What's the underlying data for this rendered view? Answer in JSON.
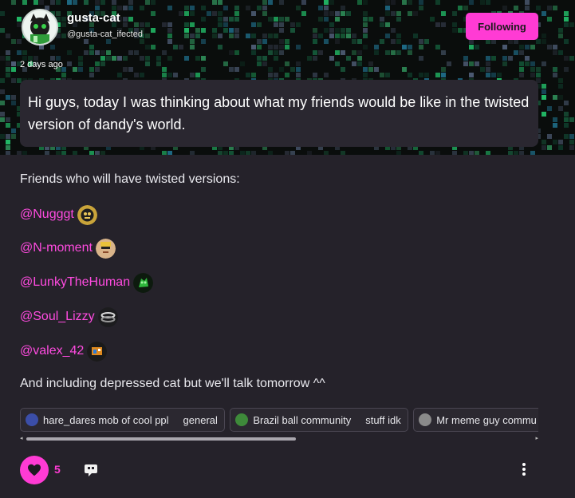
{
  "post": {
    "author": {
      "username": "gusta-cat",
      "handle": "@gusta-cat_ifected",
      "avatar_icon": "cat-avatar-icon"
    },
    "follow_label": "Following",
    "time_ago": "2 days ago",
    "title": "Hi guys, today I was thinking about what my friends would be like in the twisted version of dandy's world.",
    "intro": "Friends who will have twisted versions:",
    "mentions": [
      {
        "name": "@Nugggt",
        "avatar_color": "#c9a43a"
      },
      {
        "name": "@N-moment",
        "avatar_color": "#d9b48a"
      },
      {
        "name": "@LunkyTheHuman",
        "avatar_color": "#1f7a2a"
      },
      {
        "name": "@Soul_Lizzy",
        "avatar_color": "#2a2a2a"
      },
      {
        "name": "@valex_42",
        "avatar_color": "#e08a1e"
      }
    ],
    "closing": "And including depressed cat but we'll talk tomorrow ^^"
  },
  "tags": [
    {
      "community": "hare_dares mob of cool ppl",
      "topic": "general",
      "icon_color": "#3b4ea8"
    },
    {
      "community": "Brazil ball community",
      "topic": "stuff idk",
      "icon_color": "#3e8a3a"
    },
    {
      "community": "Mr meme guy commu",
      "topic": "",
      "icon_color": "#8a8a8a"
    }
  ],
  "actions": {
    "like_count": "5",
    "like_icon": "heart-icon",
    "comment_icon": "comment-icon",
    "more_icon": "more-vertical-icon"
  },
  "colors": {
    "accent": "#ff3bd4",
    "background": "#25222a",
    "mention": "#ff4be0"
  }
}
